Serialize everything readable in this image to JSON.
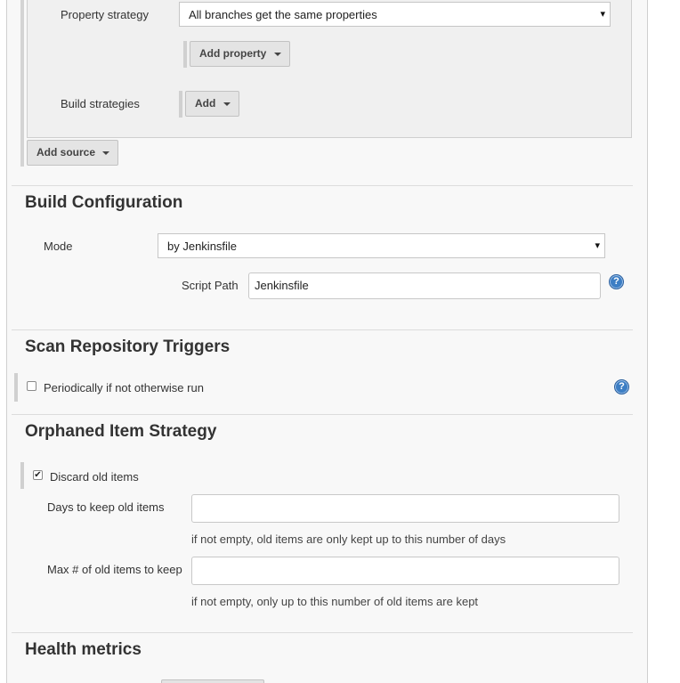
{
  "source": {
    "property_strategy_label": "Property strategy",
    "property_strategy_value": "All branches get the same properties",
    "add_property_label": "Add property",
    "build_strategies_label": "Build strategies",
    "add_label": "Add",
    "add_source_label": "Add source"
  },
  "build_configuration": {
    "title": "Build Configuration",
    "mode_label": "Mode",
    "mode_value": "by Jenkinsfile",
    "script_path_label": "Script Path",
    "script_path_value": "Jenkinsfile"
  },
  "scan_triggers": {
    "title": "Scan Repository Triggers",
    "periodic_label": "Periodically if not otherwise run",
    "periodic_checked": false
  },
  "orphaned": {
    "title": "Orphaned Item Strategy",
    "discard_label": "Discard old items",
    "discard_checked": true,
    "days_label": "Days to keep old items",
    "days_value": "",
    "days_hint": "if not empty, old items are only kept up to this number of days",
    "max_label": "Max # of old items to keep",
    "max_value": "",
    "max_hint": "if not empty, only up to this number of old items are kept"
  },
  "health": {
    "title": "Health metrics"
  },
  "icons": {
    "help": "?",
    "check": "✔",
    "select_caret": "▾"
  }
}
